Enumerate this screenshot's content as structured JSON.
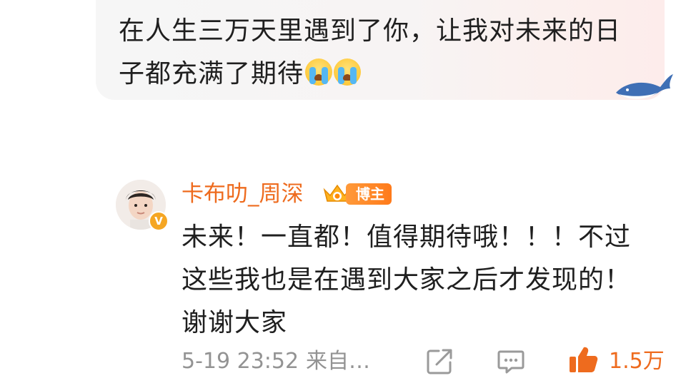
{
  "quoted_comment": {
    "text": "在人生三万天里遇到了你，让我对未来的日子都充满了期待",
    "emojis": [
      "crying-face-icon",
      "crying-face-icon"
    ]
  },
  "reply": {
    "username": "卡布叻_周深",
    "owner_tag": "博主",
    "text": "未来！一直都！值得期待哦！！！不过这些我也是在遇到大家之后才发现的！谢谢大家",
    "timestamp": "5-19 23:52",
    "source": "来自…",
    "like_count": "1.5万"
  },
  "colors": {
    "username": "#ee6b1e",
    "meta_text": "#939393",
    "like_active": "#ee6b1e"
  },
  "icons": {
    "share": "share-icon",
    "comment": "comment-icon",
    "like": "like-icon",
    "verified": "verified-badge-icon",
    "level": "crown-level-icon",
    "watermark": "whale-icon"
  }
}
